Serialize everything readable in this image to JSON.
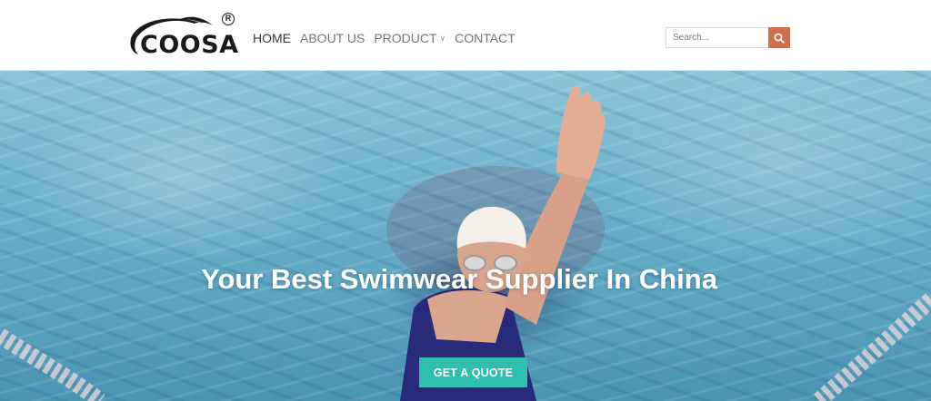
{
  "brand": {
    "name": "COOSA",
    "registered_mark": "R"
  },
  "nav": {
    "items": [
      {
        "label": "HOME"
      },
      {
        "label": "ABOUT US"
      },
      {
        "label": "PRODUCT"
      },
      {
        "label": "CONTACT"
      }
    ]
  },
  "search": {
    "placeholder": "Search...",
    "button_icon": "search-icon",
    "button_color": "#d26e4b"
  },
  "hero": {
    "title": "Your Best Swimwear Supplier In China",
    "cta_label": "GET A QUOTE",
    "cta_color": "#2ebfaf"
  }
}
